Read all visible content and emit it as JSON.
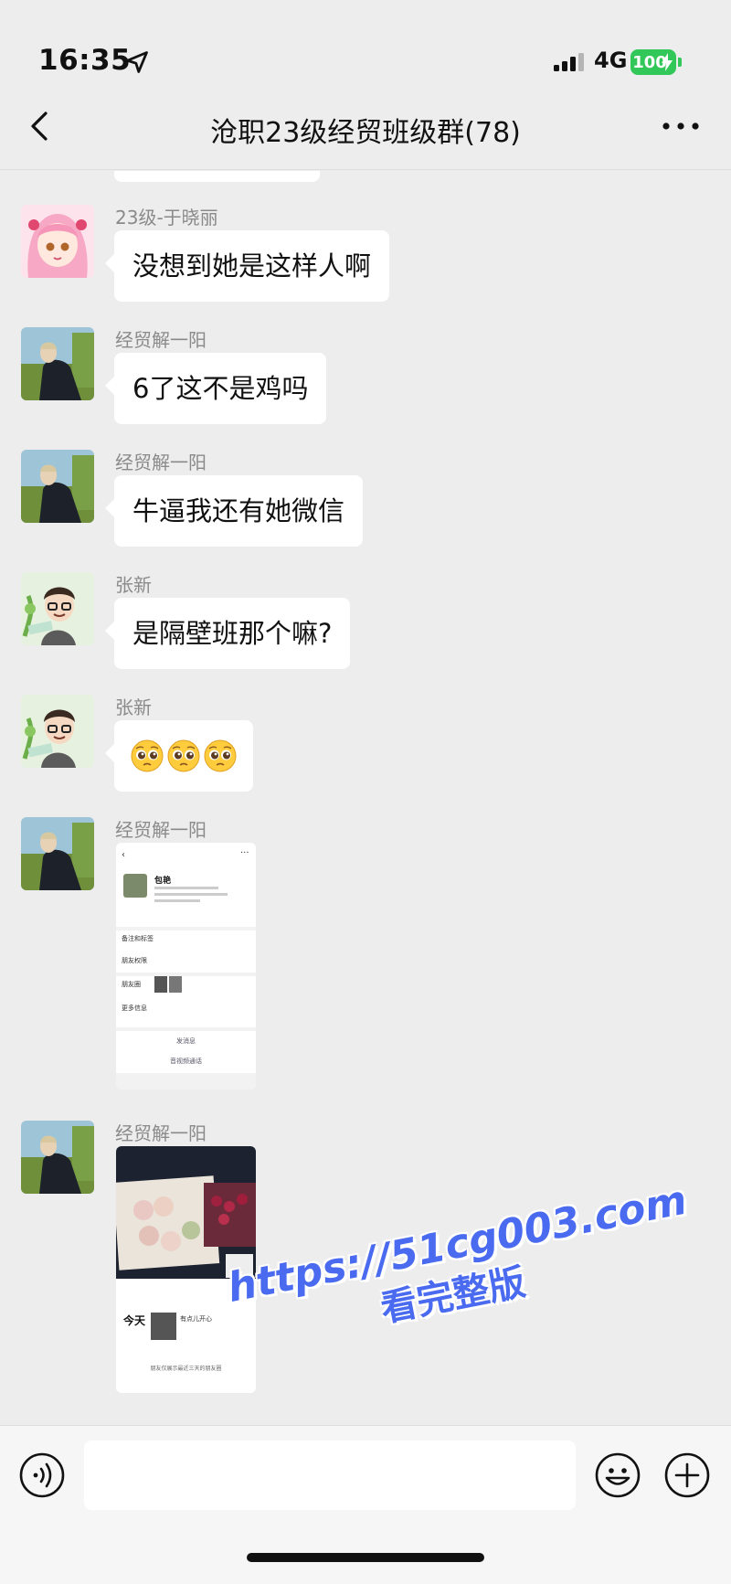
{
  "status_bar": {
    "time": "16:35",
    "network": "4G",
    "battery": "100"
  },
  "nav": {
    "title": "沧职23级经贸班级群(78)"
  },
  "messages": [
    {
      "sender": "23级-于晓丽",
      "text": "没想到她是这样人啊",
      "avatar": "anime-girl-avatar"
    },
    {
      "sender": "经贸解一阳",
      "text": "6了这不是鸡吗",
      "avatar": "man-coat-avatar"
    },
    {
      "sender": "经贸解一阳",
      "text": "牛逼我还有她微信",
      "avatar": "man-coat-avatar"
    },
    {
      "sender": "张新",
      "text": "是隔壁班那个嘛?",
      "avatar": "cartoon-glasses-avatar"
    },
    {
      "sender": "张新",
      "emoji_count": 3,
      "emoji": "pleading-face",
      "avatar": "cartoon-glasses-avatar"
    },
    {
      "sender": "经贸解一阳",
      "image": "contact-profile-screenshot",
      "avatar": "man-coat-avatar"
    },
    {
      "sender": "经贸解一阳",
      "image": "moments-screenshot",
      "avatar": "man-coat-avatar"
    }
  ],
  "screenshot_profile": {
    "name": "包艳",
    "rows": [
      "备注和标签",
      "朋友权限",
      "朋友圈",
      "更多信息"
    ],
    "send_message": "发消息",
    "video_call": "音视频通话"
  },
  "screenshot_moments": {
    "today": "今天",
    "post_text": "有点儿开心",
    "footer": "朋友仅展示最近三天的朋友圈"
  },
  "input": {
    "placeholder": ""
  },
  "watermark": {
    "url": "https://51cg003.com",
    "subtitle": "看完整版"
  },
  "colors": {
    "background": "#ededed",
    "bubble": "#ffffff",
    "battery": "#32c759",
    "watermark": "#4a6bf0"
  }
}
